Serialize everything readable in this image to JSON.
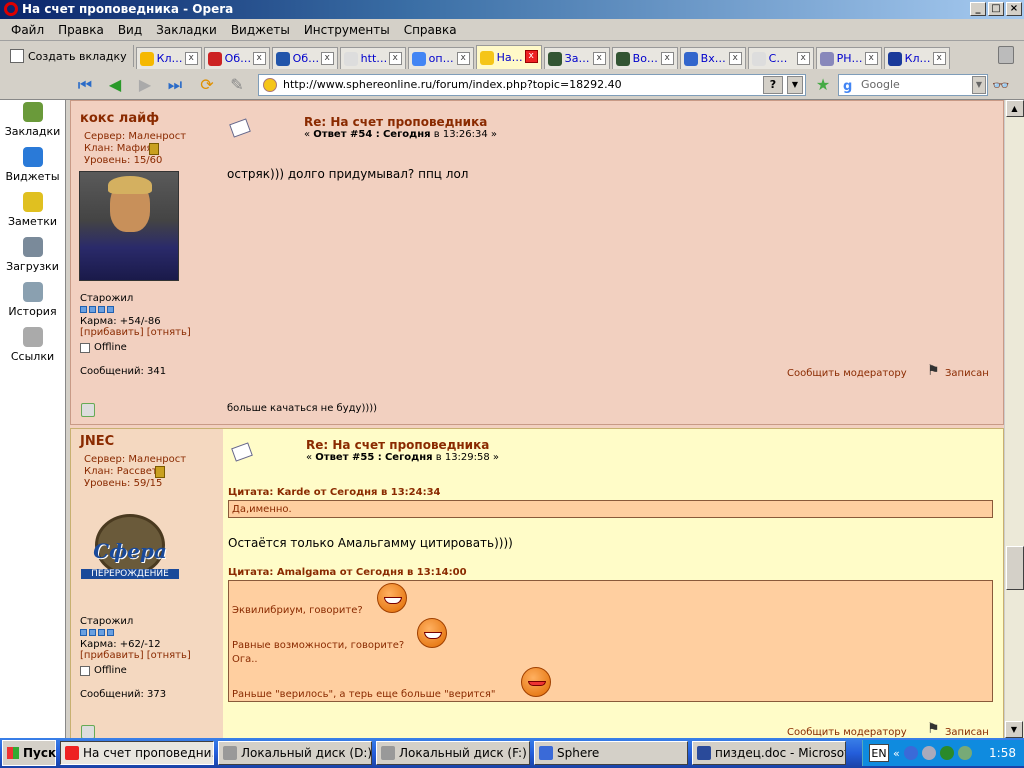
{
  "window": {
    "title": "На счет проповедника - Opera"
  },
  "menu": [
    "Файл",
    "Правка",
    "Вид",
    "Закладки",
    "Виджеты",
    "Инструменты",
    "Справка"
  ],
  "tabs": {
    "new_tab": "Создать вкладку",
    "items": [
      {
        "label": "Кл…",
        "icon_color": "#f5b800",
        "active": false
      },
      {
        "label": "Об…",
        "icon_color": "#c22",
        "active": false
      },
      {
        "label": "Об…",
        "icon_color": "#2255aa",
        "active": false
      },
      {
        "label": "htt…",
        "icon_color": "#dddddd",
        "active": false
      },
      {
        "label": "оп…",
        "icon_color": "#4285f4",
        "active": false
      },
      {
        "label": "На…",
        "icon_color": "#f5c518",
        "active": true
      },
      {
        "label": "За…",
        "icon_color": "#335533",
        "active": false
      },
      {
        "label": "Во…",
        "icon_color": "#335533",
        "active": false
      },
      {
        "label": "Вх…",
        "icon_color": "#3366cc",
        "active": false
      },
      {
        "label": "С…",
        "icon_color": "#dddddd",
        "active": false
      },
      {
        "label": "PH…",
        "icon_color": "#8888bb",
        "active": false
      },
      {
        "label": "Кл…",
        "icon_color": "#1a3a9a",
        "active": false
      }
    ]
  },
  "address": {
    "url": "http://www.sphereonline.ru/forum/index.php?topic=18292.40",
    "help": "?"
  },
  "search": {
    "placeholder": "Google"
  },
  "sidebar": [
    {
      "label": "Закладки",
      "icon": "bookmarks-icon",
      "color": "#6a9a3a"
    },
    {
      "label": "Виджеты",
      "icon": "widgets-icon",
      "color": "#2a7ad8"
    },
    {
      "label": "Заметки",
      "icon": "notes-icon",
      "color": "#e0c020"
    },
    {
      "label": "Загрузки",
      "icon": "downloads-icon",
      "color": "#7a8a9a"
    },
    {
      "label": "История",
      "icon": "history-icon",
      "color": "#8aa0b0"
    },
    {
      "label": "Ссылки",
      "icon": "links-icon",
      "color": "#aaaaaa"
    }
  ],
  "post1": {
    "author": "кокс лайф",
    "server": "Сервер: Маленрост",
    "clan": "Клан: Мафия",
    "level": "Уровень: 15/60",
    "rank": "Старожил",
    "karma": "Карма: +54/-86",
    "karma_links": "[прибавить] [отнять]",
    "status": "Offline",
    "messages": "Сообщений: 341",
    "title": "Re: На счет проповедника",
    "meta_prefix": "« ",
    "meta_reply": "Ответ #54 :",
    "meta_day": "Сегодня",
    "meta_time": " в 13:26:34 »",
    "body": "остряк))) долго придумывал? ппц лол",
    "signature": "больше качаться не буду))))",
    "report": "Сообщить модератору",
    "logged": "Записан"
  },
  "post2": {
    "author": "JNEC",
    "server": "Сервер: Маленрост",
    "clan": "Клан: Рассвет",
    "level": "Уровень: 59/15",
    "avatar_title": "Сфера",
    "avatar_subtitle": "ПЕРЕРОЖДЕНИЕ",
    "rank": "Старожил",
    "karma": "Карма: +62/-12",
    "karma_links": "[прибавить] [отнять]",
    "status": "Offline",
    "messages": "Сообщений: 373",
    "title": "Re: На счет проповедника",
    "meta_prefix": "« ",
    "meta_reply": "Ответ #55 :",
    "meta_day": "Сегодня",
    "meta_time": " в 13:29:58 »",
    "quote1_header": "Цитата: Karde от Сегодня в 13:24:34",
    "quote1_text": "Да,именно.",
    "body": "Остаётся только Амальгамму цитировать))))",
    "quote2_header": "Цитата: Amalgama от Сегодня в 13:14:00",
    "quote2_lines": [
      "Эквилибриум, говорите?",
      "Равные возможности, говорите?",
      "Ога..",
      "Раньше \"верилось\", а терь еще больше \"верится\""
    ],
    "report": "Сообщить модератору",
    "logged": "Записан"
  },
  "taskbar": {
    "start": "Пуск",
    "tasks": [
      {
        "label": "На счет проповедни...",
        "active": true
      },
      {
        "label": "Локальный диск (D:)",
        "active": false
      },
      {
        "label": "Локальный диск (F:)",
        "active": false
      },
      {
        "label": "Sphere",
        "active": false
      },
      {
        "label": "пиздец.doc - Microsoft ...",
        "active": false
      }
    ],
    "lang": "EN",
    "clock": "1:58"
  }
}
